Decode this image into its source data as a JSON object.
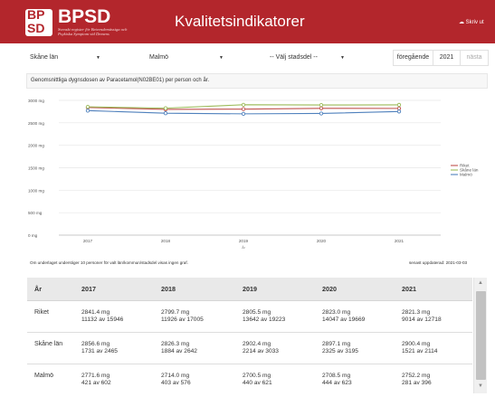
{
  "header": {
    "logo_top": "BP",
    "logo_bottom": "SD",
    "brand": "BPSD",
    "brand_sub": "Svenskt register för Beteendemässiga och Psykiska Symptom vid Demens",
    "title": "Kvalitetsindikatorer",
    "print_label": "☁ Skriv ut"
  },
  "filters": {
    "region": "Skåne län",
    "municipality": "Malmö",
    "district": "-- Välj stadsdel --",
    "caret": "▼"
  },
  "year_nav": {
    "prev": "föregående",
    "current": "2021",
    "next": "nästa"
  },
  "chart_title": "Genomsnittliga dygnsdosen av Paracetamol(N02BE01) per person och år.",
  "chart_data": {
    "type": "line",
    "title": "Genomsnittliga dygnsdosen av Paracetamol(N02BE01) per person och år.",
    "xlabel": "År",
    "ylabel": "",
    "x": [
      "2017",
      "2018",
      "2019",
      "2020",
      "2021"
    ],
    "y_ticks": [
      "0 mg",
      "500 mg",
      "1000 mg",
      "1500 mg",
      "2000 mg",
      "2500 mg",
      "3000 mg"
    ],
    "ylim": [
      0,
      3000
    ],
    "grid": true,
    "legend_position": "right",
    "series": [
      {
        "name": "Riket",
        "color": "#c0504d",
        "values": [
          2841.4,
          2799.7,
          2805.5,
          2823.0,
          2821.3
        ]
      },
      {
        "name": "Skåne län",
        "color": "#9bbb59",
        "values": [
          2856.6,
          2826.3,
          2902.4,
          2897.1,
          2900.4
        ]
      },
      {
        "name": "Malmö",
        "color": "#4f81bd",
        "values": [
          2771.6,
          2714.0,
          2700.5,
          2708.5,
          2752.2
        ]
      }
    ]
  },
  "note_left": "Om underlaget understiger 10 personer för valt län/kommun/stadsdel visas ingen graf.",
  "note_right": "senast uppdaterad: 2021-03-03",
  "table": {
    "headers": [
      "År",
      "2017",
      "2018",
      "2019",
      "2020",
      "2021"
    ],
    "rows": [
      {
        "label": "Riket",
        "cells": [
          {
            "dose": "2841.4 mg",
            "count": "11132 av 15946"
          },
          {
            "dose": "2799.7 mg",
            "count": "11926 av 17005"
          },
          {
            "dose": "2805.5 mg",
            "count": "13642 av 19223"
          },
          {
            "dose": "2823.0 mg",
            "count": "14047 av 19669"
          },
          {
            "dose": "2821.3 mg",
            "count": "9014 av 12718"
          }
        ]
      },
      {
        "label": "Skåne län",
        "cells": [
          {
            "dose": "2856.6 mg",
            "count": "1731 av 2465"
          },
          {
            "dose": "2826.3 mg",
            "count": "1884 av 2642"
          },
          {
            "dose": "2902.4 mg",
            "count": "2214 av 3033"
          },
          {
            "dose": "2897.1 mg",
            "count": "2325 av 3195"
          },
          {
            "dose": "2900.4 mg",
            "count": "1521 av 2114"
          }
        ]
      },
      {
        "label": "Malmö",
        "cells": [
          {
            "dose": "2771.6 mg",
            "count": "421 av 602"
          },
          {
            "dose": "2714.0 mg",
            "count": "403 av 576"
          },
          {
            "dose": "2700.5 mg",
            "count": "440 av 621"
          },
          {
            "dose": "2708.5 mg",
            "count": "444 av 623"
          },
          {
            "dose": "2752.2 mg",
            "count": "281 av 396"
          }
        ]
      }
    ]
  },
  "colors": {
    "brand_red": "#b3262c"
  }
}
